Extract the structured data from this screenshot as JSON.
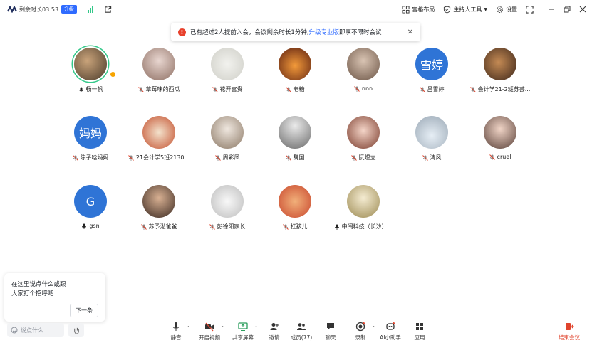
{
  "topbar": {
    "remaining": "剩余时长03:53",
    "upgrade": "升级",
    "layout": "宫格布局",
    "host_tools": "主持人工具",
    "settings": "设置"
  },
  "notice": {
    "text_before": "已有超过2人提前入会，会议剩余时长1分钟,",
    "link": "升级专业版",
    "text_after": "即享不限时会议"
  },
  "participants": [
    {
      "name": "畅一帆",
      "avatar_text": "",
      "muted": false
    },
    {
      "name": "草莓味的西瓜",
      "avatar_text": "",
      "muted": true
    },
    {
      "name": "花开富贵",
      "avatar_text": "",
      "muted": true
    },
    {
      "name": "老糖",
      "avatar_text": "",
      "muted": true
    },
    {
      "name": "nnn",
      "avatar_text": "",
      "muted": true
    },
    {
      "name": "吕雪婷",
      "avatar_text": "雪婷",
      "muted": true
    },
    {
      "name": "会计学21-2班苏芸...",
      "avatar_text": "",
      "muted": true
    },
    {
      "name": "陈子晗妈妈",
      "avatar_text": "妈妈",
      "muted": true
    },
    {
      "name": "21会计学5班2130...",
      "avatar_text": "",
      "muted": true
    },
    {
      "name": "周彩凤",
      "avatar_text": "",
      "muted": true
    },
    {
      "name": "魏国",
      "avatar_text": "",
      "muted": true
    },
    {
      "name": "阮煜立",
      "avatar_text": "",
      "muted": true
    },
    {
      "name": "清风",
      "avatar_text": "",
      "muted": true
    },
    {
      "name": "cruel",
      "avatar_text": "",
      "muted": true
    },
    {
      "name": "gsn",
      "avatar_text": "G",
      "muted": false
    },
    {
      "name": "苏予泓爸爸",
      "avatar_text": "",
      "muted": true
    },
    {
      "name": "彭徐阳家长",
      "avatar_text": "",
      "muted": true
    },
    {
      "name": "杠孩儿",
      "avatar_text": "",
      "muted": true
    },
    {
      "name": "中闽科技（长沙）...",
      "avatar_text": "",
      "muted": false
    }
  ],
  "bubble": {
    "text": "在这里说点什么或跟大家打个招呼吧",
    "next": "下一条"
  },
  "bottombar": {
    "chat_placeholder": "说点什么...",
    "mute": "静音",
    "video": "开启视频",
    "share": "共享屏幕",
    "invite": "邀请",
    "members": "成员(77)",
    "chat": "聊天",
    "record": "录制",
    "ai": "AI小助手",
    "apps": "应用",
    "end": "结束会议"
  }
}
